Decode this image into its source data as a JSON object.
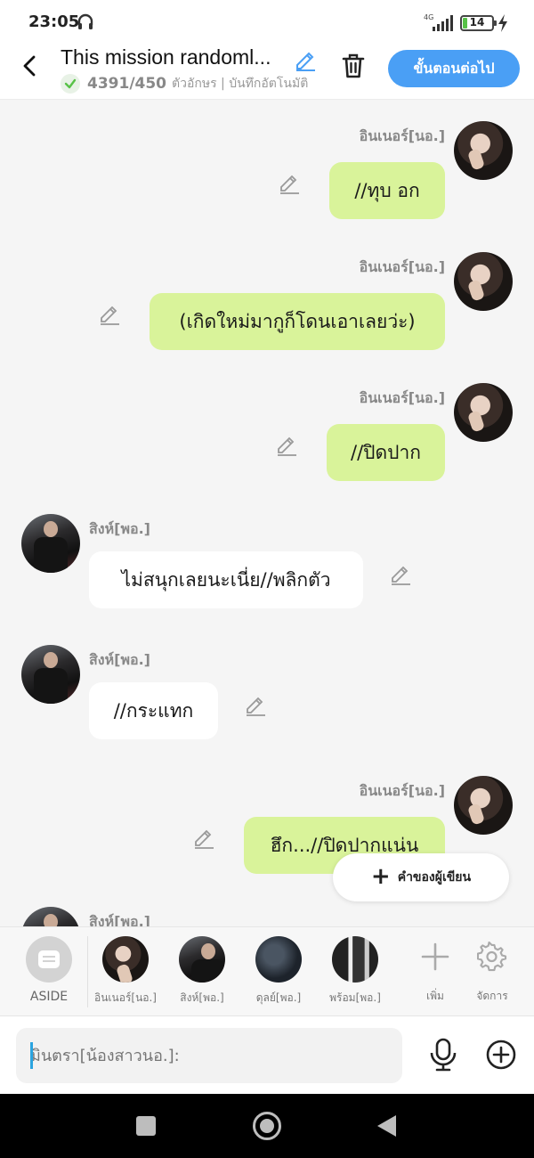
{
  "status": {
    "time": "23:05",
    "network": "4G",
    "battery": "14",
    "battery_level": 0.14
  },
  "header": {
    "title": "This mission randoml...",
    "count": "4391/450",
    "sub_rest": "ตัวอักษร | บันทึกอัตโนมัติ",
    "next_label": "ขั้นตอนต่อไป"
  },
  "messages": [
    {
      "side": "right",
      "speaker": "อินเนอร์[นอ.]",
      "text": "//ทุบ อก",
      "avatar": "girl"
    },
    {
      "side": "right",
      "speaker": "อินเนอร์[นอ.]",
      "text": "(เกิดใหม่มากูก็โดนเอาเลยว่ะ)",
      "avatar": "girl"
    },
    {
      "side": "right",
      "speaker": "อินเนอร์[นอ.]",
      "text": "//ปิดปาก",
      "avatar": "girl"
    },
    {
      "side": "left",
      "speaker": "สิงห์[พอ.]",
      "text": "ไม่สนุกเลยนะเนี่ย//พลิกตัว",
      "avatar": "boy"
    },
    {
      "side": "left",
      "speaker": "สิงห์[พอ.]",
      "text": "//กระแทก",
      "avatar": "boy"
    },
    {
      "side": "right",
      "speaker": "อินเนอร์[นอ.]",
      "text": "ฮึก...//ปิดปากแน่น",
      "avatar": "girl"
    },
    {
      "side": "left",
      "speaker": "สิงห์[พอ.]",
      "text": "",
      "avatar": "boy"
    }
  ],
  "author_button": "คำของผู้เขียน",
  "characters": {
    "aside": "ASIDE",
    "list": [
      "อินเนอร์[นอ.]",
      "สิงห์[พอ.]",
      "ดุลย์[พอ.]",
      "พร้อม[พอ.]"
    ],
    "add_label": "เพิ่ม",
    "manage_label": "จัดการ"
  },
  "composer": {
    "placeholder": "มินตรา[น้องสาวนอ.]:"
  },
  "colors": {
    "accent": "#4a9ff5",
    "bubble_right": "#d9f39a",
    "bubble_left": "#ffffff",
    "check": "#58c248"
  }
}
